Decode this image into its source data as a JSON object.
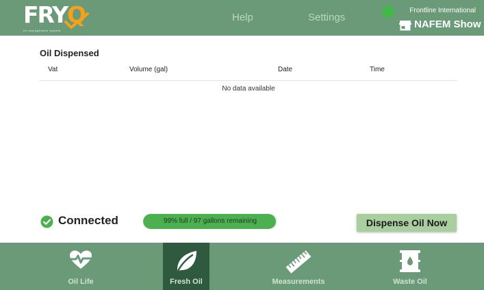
{
  "header": {
    "logo": {
      "text_main": "FRY",
      "text_q": "Q",
      "tagline": "oil management system"
    },
    "nav": {
      "help": "Help",
      "settings": "Settings"
    },
    "organization": "Frontline International",
    "store": "NAFEM Show",
    "connection_status_color": "#42b84a"
  },
  "main": {
    "title": "Oil Dispensed",
    "table": {
      "columns": [
        "Vat",
        "Volume (gal)",
        "Date",
        "Time"
      ],
      "rows": [],
      "empty_message": "No data available"
    }
  },
  "status": {
    "connected_label": "Connected",
    "level_text": "99% full / 97 gallons remaining",
    "level_fraction": 0.99,
    "dispense_button": "Dispense Oil Now"
  },
  "bottom_nav": {
    "tabs": [
      {
        "label": "Oil Life",
        "icon": "heart-pulse-icon",
        "active": false
      },
      {
        "label": "Fresh Oil",
        "icon": "leaf-icon",
        "active": true
      },
      {
        "label": "Measurements",
        "icon": "ruler-icon",
        "active": false
      },
      {
        "label": "Waste Oil",
        "icon": "oil-barrel-icon",
        "active": false
      }
    ]
  },
  "colors": {
    "header_bg": "#6a9a78",
    "active_tab_bg": "#2f5a3f",
    "accent_green": "#4caf50",
    "logo_accent": "#f4a21b",
    "dispense_button_bg": "#a9cfa0"
  }
}
